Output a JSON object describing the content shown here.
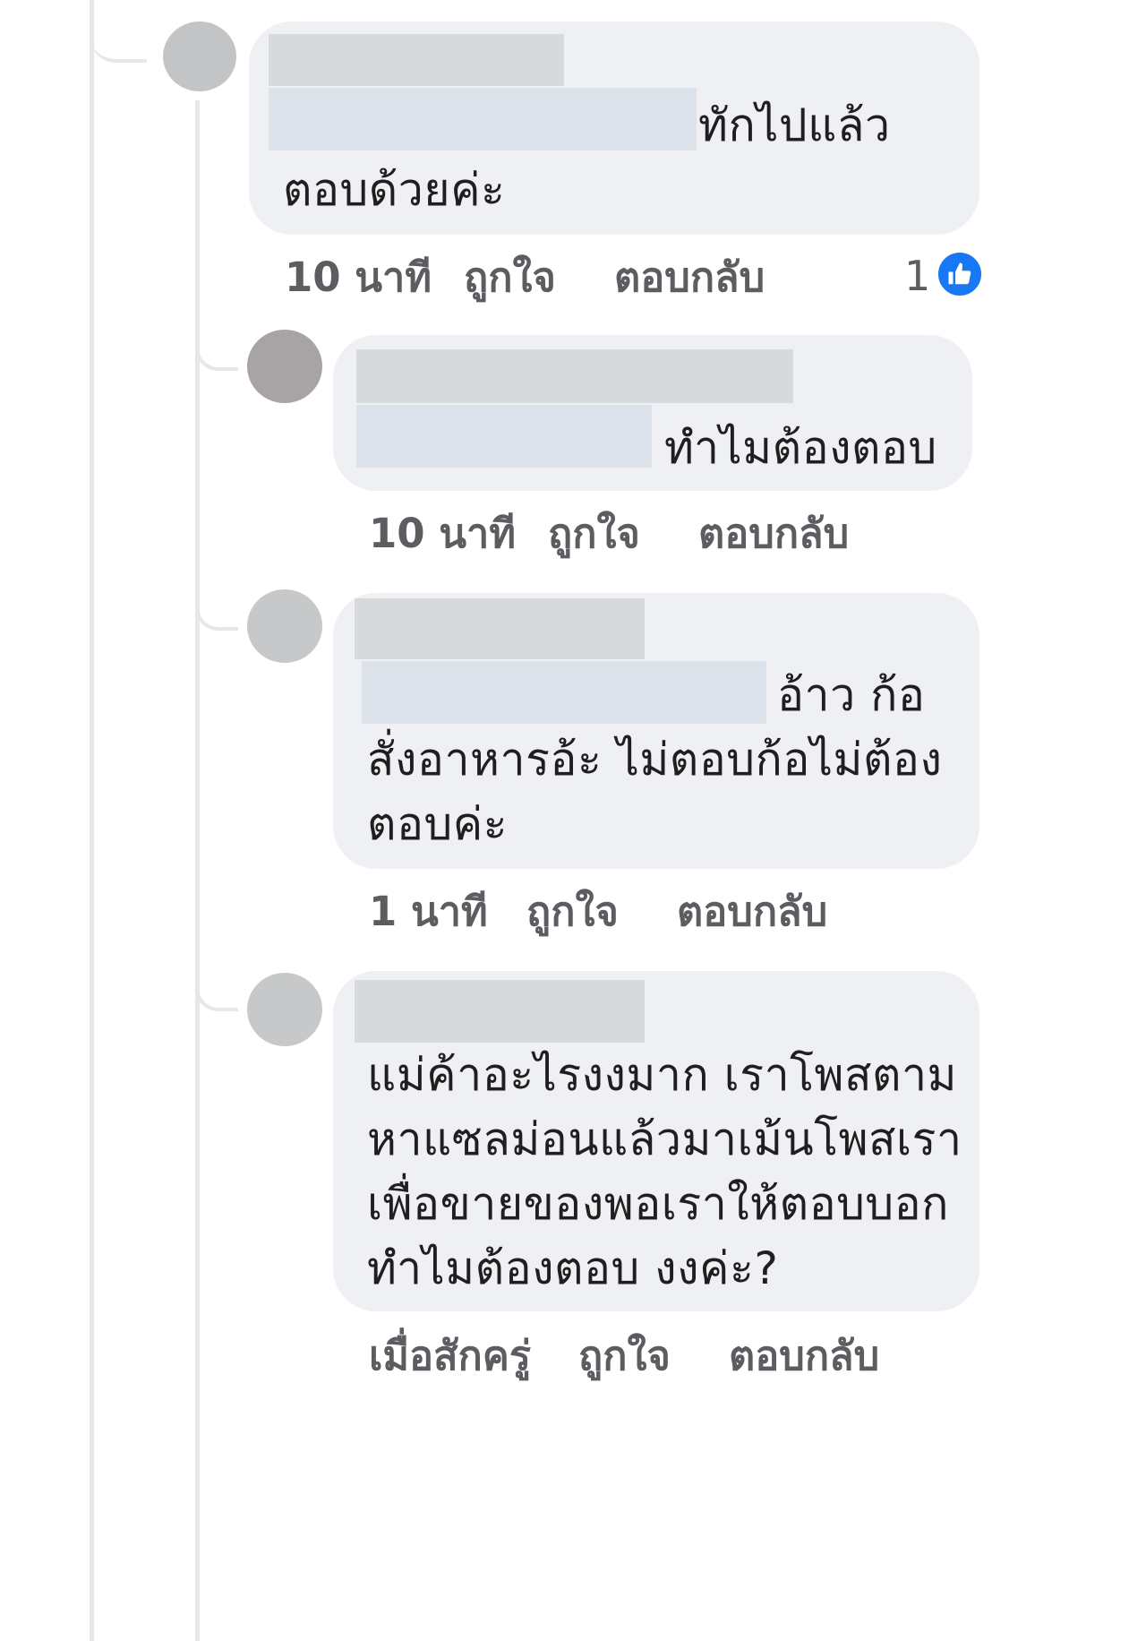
{
  "colors": {
    "bubble": "#eef0f3",
    "thread_line": "#e6e7ea",
    "meta_text": "#5b5d61",
    "like_blue": "#1877f2"
  },
  "comments": [
    {
      "text_lines": [
        "ทักไปแล้ว",
        "ตอบด้วยค่ะ"
      ],
      "time": "10 นาที",
      "like_label": "ถูกใจ",
      "reply_label": "ตอบกลับ",
      "reaction_count": "1",
      "reaction_icon": "thumbs-up-icon"
    },
    {
      "text_lines": [
        "ทำไมต้องตอบ"
      ],
      "time": "10 นาที",
      "like_label": "ถูกใจ",
      "reply_label": "ตอบกลับ"
    },
    {
      "text_lines": [
        "อ้าว ก้อ",
        "สั่งอาหารอ้ะ ไม่ตอบก้อไม่ต้อง",
        "ตอบค่ะ"
      ],
      "time": "1 นาที",
      "like_label": "ถูกใจ",
      "reply_label": "ตอบกลับ"
    },
    {
      "text_lines": [
        "แม่ค้าอะไรงงมาก เราโพสตาม",
        "หาแซลม่อนแล้วมาเม้นโพสเรา",
        "เพื่อขายของพอเราให้ตอบบอก",
        "ทำไมต้องตอบ งงค่ะ?"
      ],
      "time": "เมื่อสักครู่",
      "like_label": "ถูกใจ",
      "reply_label": "ตอบกลับ"
    }
  ]
}
